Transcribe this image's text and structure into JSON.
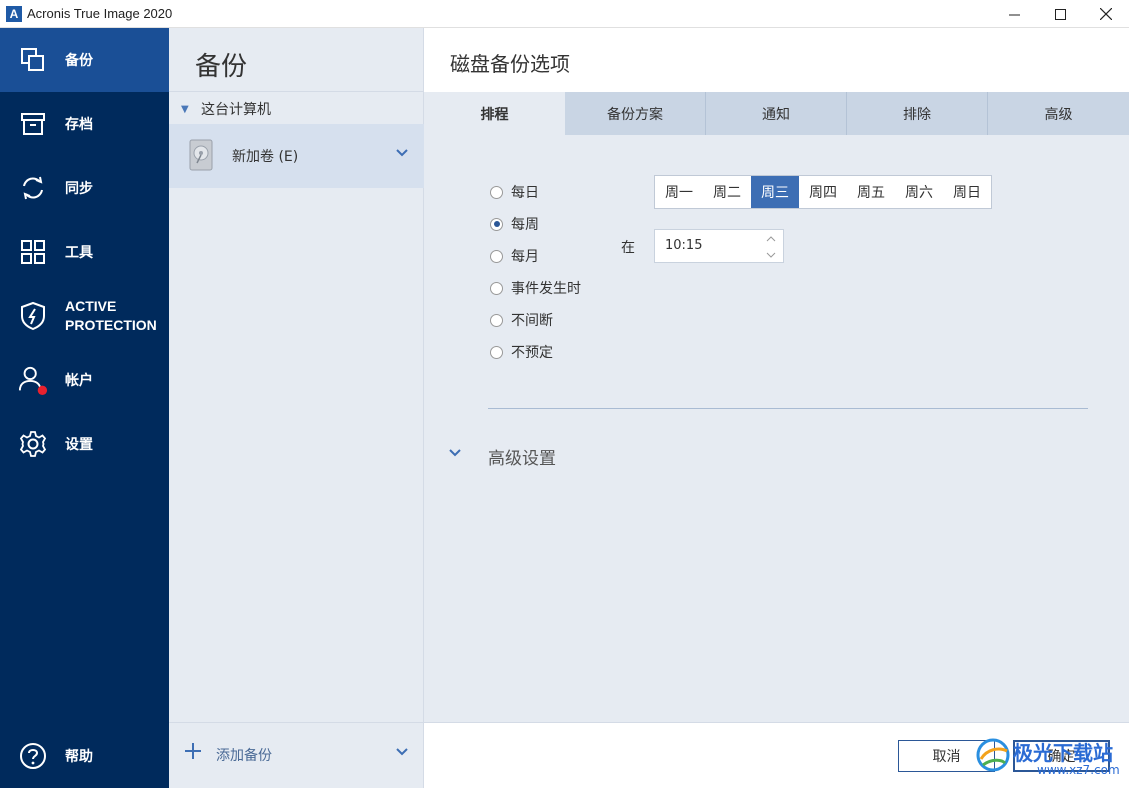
{
  "window": {
    "title": "Acronis True Image 2020",
    "logo_letter": "A",
    "controls": [
      "minimize",
      "maximize",
      "close"
    ]
  },
  "sidebar": {
    "items": [
      {
        "label": "备份",
        "icon": "copy-icon",
        "active": true
      },
      {
        "label": "存档",
        "icon": "archive-icon"
      },
      {
        "label": "同步",
        "icon": "sync-icon"
      },
      {
        "label": "工具",
        "icon": "grid-icon"
      },
      {
        "label": "ACTIVE PROTECTION",
        "icon": "shield-icon"
      },
      {
        "label": "帐户",
        "icon": "account-icon"
      },
      {
        "label": "设置",
        "icon": "gear-icon"
      }
    ],
    "help_label": "帮助"
  },
  "middle": {
    "title": "备份",
    "group_label": "这台计算机",
    "backup_item": "新加卷 (E)",
    "add_backup_label": "添加备份"
  },
  "main": {
    "title": "磁盘备份选项",
    "tabs": [
      "排程",
      "备份方案",
      "通知",
      "排除",
      "高级"
    ],
    "active_tab": 0,
    "schedule_options": [
      "每日",
      "每周",
      "每月",
      "事件发生时",
      "不间断",
      "不预定"
    ],
    "selected_option": 1,
    "days": [
      "周一",
      "周二",
      "周三",
      "周四",
      "周五",
      "周六",
      "周日"
    ],
    "selected_day": 2,
    "at_label": "在",
    "time_value": "10:15",
    "advanced_label": "高级设置",
    "cancel_label": "取消",
    "ok_label": "确定"
  },
  "watermark": {
    "text": "极光下载站",
    "url": "www.xz7.com"
  },
  "colors": {
    "sidebar_bg": "#002a5c",
    "sidebar_active": "#1a4f96",
    "accent": "#3d6eb4",
    "panel_bg": "#e6ebf2"
  }
}
